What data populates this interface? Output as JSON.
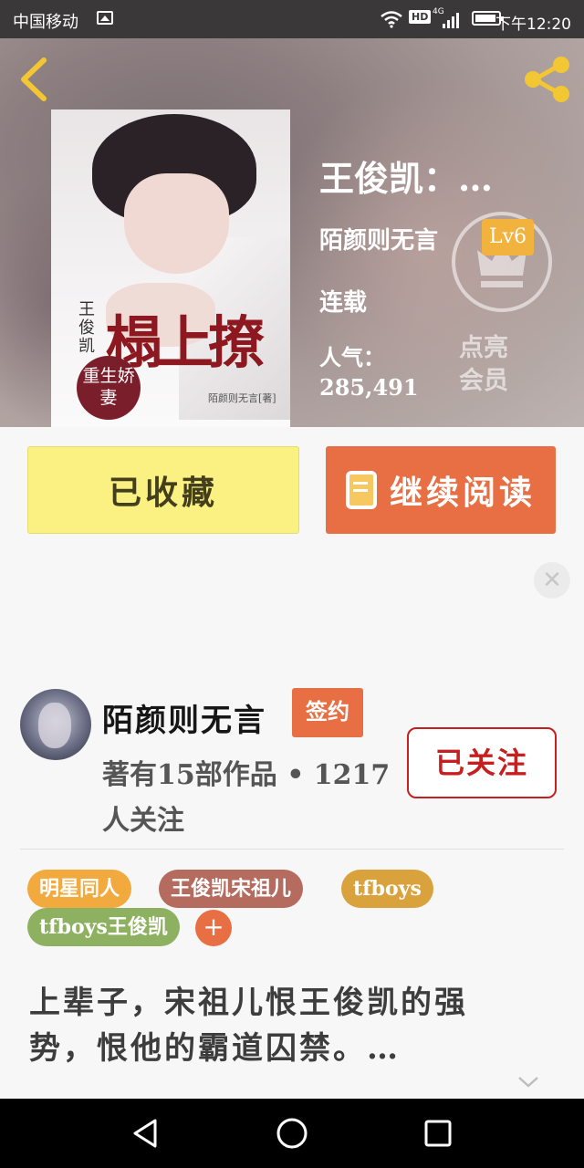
{
  "status_bar": {
    "carrier": "中国移动",
    "network": "4G",
    "hd": "HD",
    "time": "下午12:20"
  },
  "book": {
    "cover_title": "榻上撩",
    "cover_subtitle": "王俊凯",
    "cover_badge": "重生娇妻",
    "cover_author": "陌颜则无言[著]",
    "title": "王俊凯：…",
    "author": "陌颜则无言",
    "level": "Lv6",
    "status": "连载",
    "popularity_label": "人气：",
    "popularity_value": "285,491",
    "member_label": "点亮会员"
  },
  "actions": {
    "collect_label": "已收藏",
    "read_label": "继续阅读"
  },
  "ad": {
    "close_symbol": "✕"
  },
  "author_section": {
    "name": "陌颜则无言",
    "signed_badge": "签约",
    "works": "著有15部作品 • 1217人关注",
    "follow_label": "已关注"
  },
  "tags": [
    "明星同人",
    "王俊凯宋祖儿",
    "tfboys",
    "tfboys王俊凯"
  ],
  "add_tag_symbol": "+",
  "synopsis": "上辈子，宋祖儿恨王俊凯的强势，恨他的霸道囚禁。…",
  "colors": {
    "accent": "#e76f43",
    "collect_bg": "#fbf182",
    "follow_red": "#c51f1f"
  },
  "icons": [
    "back-icon",
    "share-icon",
    "crown-icon",
    "book-icon",
    "close-icon",
    "chevron-down-icon",
    "nav-back-icon",
    "nav-home-icon",
    "nav-recents-icon"
  ]
}
